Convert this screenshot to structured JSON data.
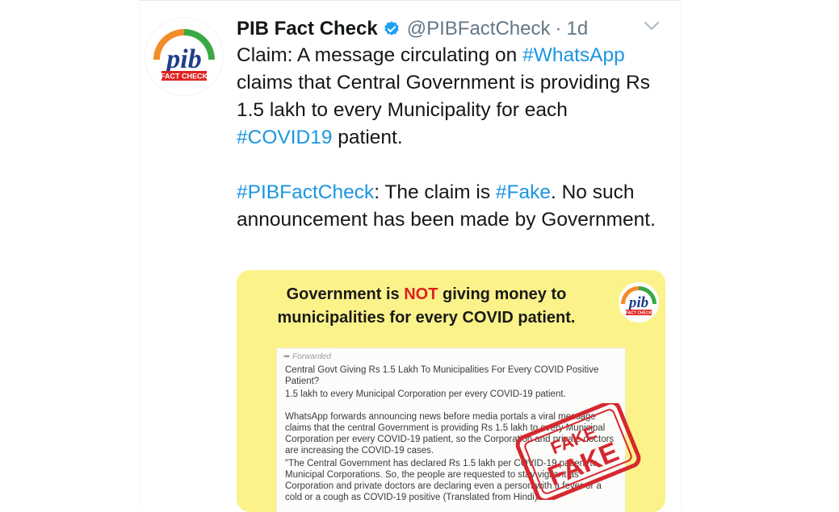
{
  "tweet": {
    "name": "PIB Fact Check",
    "handle": "@PIBFactCheck",
    "separator": "·",
    "time": "1d",
    "p1": {
      "a": "Claim: A message circulating on ",
      "tag1": "#WhatsApp",
      "b": " claims that Central Government is providing Rs 1.5 lakh to every Municipality for each ",
      "tag2": "#COVID19",
      "c": "  patient."
    },
    "p2": {
      "tag1": "#PIBFactCheck",
      "a": ": The claim is ",
      "tag2": "#Fake",
      "b": ". No such announcement has been made by Government."
    }
  },
  "avatar": {
    "logo_text": "pib",
    "badge_text": "FACT CHECK"
  },
  "media": {
    "headline_a": "Government is ",
    "headline_not": "NOT",
    "headline_b": " giving money to municipalities for every COVID patient.",
    "logo_text": "pib",
    "badge_text": "FACT CHECK",
    "forwarded": "Forwarded",
    "msg1": "Central Govt Giving Rs 1.5 Lakh To Municipalities For Every COVID Positive Patient?",
    "msg2": " 1.5 lakh to every Municipal Corporation per every COVID-19 patient.",
    "msg3": "WhatsApp forwards announcing news before media portals a viral message claims that the central Government is providing Rs 1.5 lakh to every Municipal Corporation per every COVID-19 patient, so the Corporation and private doctors are increasing the COVID-19 cases.",
    "msg4": "\"The Central Government has declared Rs 1.5 lakh per COVID-19 patient to Municipal Corporations. So, the people are requested to stay vigilant as Corporation and private doctors are declaring even a person with a fever or a cold or a cough as COVID-19 positive (Translated from Hindi)",
    "stamp_text": "FAKE"
  },
  "colors": {
    "link": "#1b95e0",
    "verified": "#1da1f2",
    "muted": "#657786",
    "card_bg": "#fbf28a",
    "alert_red": "#e02020",
    "stamp_red": "#d6282e"
  },
  "icons": {
    "verified": "verified-badge-icon",
    "caret": "chevron-down-icon"
  }
}
